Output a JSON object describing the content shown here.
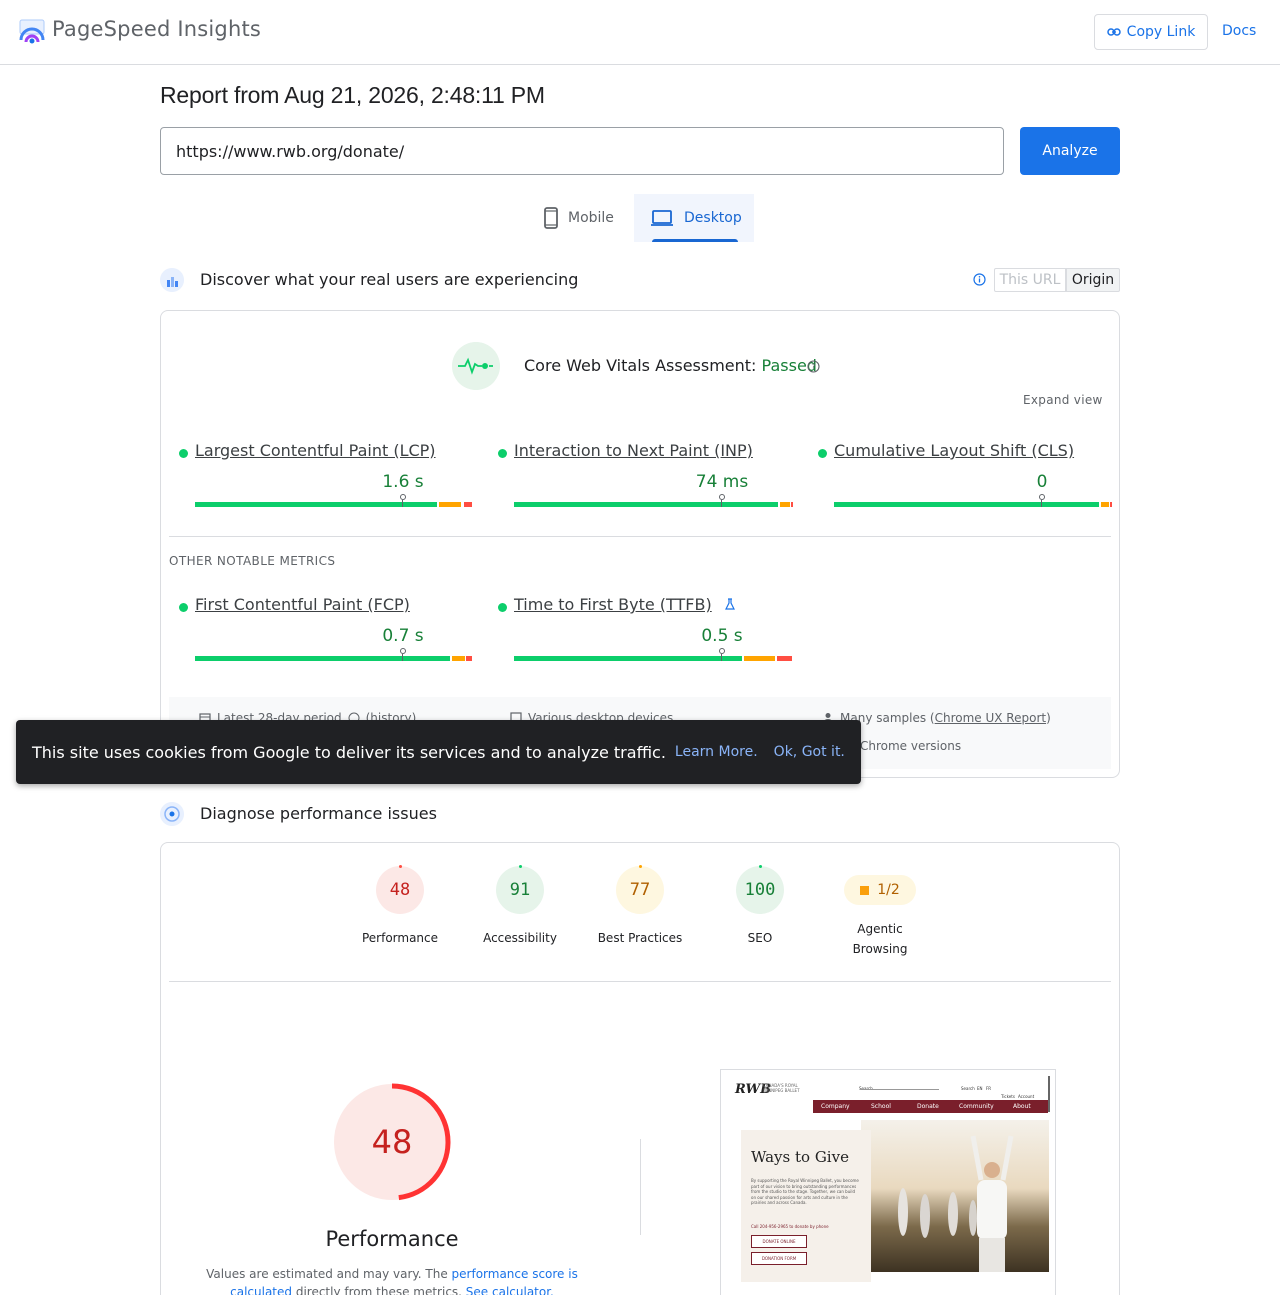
{
  "header": {
    "brand": "PageSpeed Insights",
    "copy_link": "Copy Link",
    "docs": "Docs"
  },
  "report": {
    "title": "Report from Aug 21, 2026, 2:48:11 PM",
    "url": "https://www.rwb.org/donate/",
    "analyze": "Analyze"
  },
  "tabs": {
    "mobile": "Mobile",
    "desktop": "Desktop",
    "active": "desktop"
  },
  "field": {
    "title": "Discover what your real users are experiencing",
    "toggle_this_url": "This URL",
    "toggle_origin": "Origin",
    "cwv_label": "Core Web Vitals Assessment:",
    "cwv_status": "Passed",
    "expand": "Expand view",
    "other_label": "OTHER NOTABLE METRICS",
    "metrics": [
      {
        "name": "Largest Contentful Paint (LCP)",
        "value": "1.6 s"
      },
      {
        "name": "Interaction to Next Paint (INP)",
        "value": "74 ms"
      },
      {
        "name": "Cumulative Layout Shift (CLS)",
        "value": "0"
      },
      {
        "name": "First Contentful Paint (FCP)",
        "value": "0.7 s"
      },
      {
        "name": "Time to First Byte (TTFB)",
        "value": "0.5 s"
      }
    ],
    "footer": {
      "period": "Latest 28-day period",
      "history": "(history)",
      "devices": "Various desktop devices",
      "samples_prefix": "Many samples (",
      "samples_link": "Chrome UX Report",
      "samples_suffix": ")",
      "chrome": "Chrome versions"
    }
  },
  "cookie": {
    "message": "This site uses cookies from Google to deliver its services and to analyze traffic.",
    "learn_more": "Learn More.",
    "ok": "Ok, Got it."
  },
  "diagnose": {
    "title": "Diagnose performance issues",
    "scores": [
      {
        "label": "Performance",
        "value": "48"
      },
      {
        "label": "Accessibility",
        "value": "91"
      },
      {
        "label": "Best Practices",
        "value": "77"
      },
      {
        "label": "SEO",
        "value": "100"
      }
    ],
    "agentic": {
      "value": "1/2",
      "label": "Agentic Browsing"
    },
    "big": {
      "score": "48",
      "score_fraction": 0.48,
      "label": "Performance",
      "note_pre": "Values are estimated and may vary. The ",
      "note_link1": "performance score is calculated",
      "note_mid": " directly from these metrics. ",
      "note_link2": "See calculator."
    }
  },
  "thumbnail": {
    "logo": "RWB",
    "logo_sub_1": "CANADA'S ROYAL",
    "logo_sub_2": "WINNIPEG BALLET",
    "search": "Search",
    "util": [
      "Search",
      "EN",
      "FR",
      "Tickets",
      "Account"
    ],
    "nav": [
      "Company",
      "School",
      "Donate",
      "Community",
      "About"
    ],
    "heading": "Ways to Give",
    "paragraph": "By supporting the Royal Winnipeg Ballet, you become part of our vision to bring outstanding performances from the studio to the stage. Together, we can build on our shared passion for arts and culture in the prairies and across Canada.",
    "call": "Call 204-956-2965 to donate by phone",
    "donate_online": "DONATE ONLINE",
    "donation_form": "DONATION FORM"
  },
  "colors": {
    "good": "#0cce6b",
    "needs_improvement": "#ffa400",
    "poor": "#ff4e42",
    "accent": "#1a73e8"
  }
}
